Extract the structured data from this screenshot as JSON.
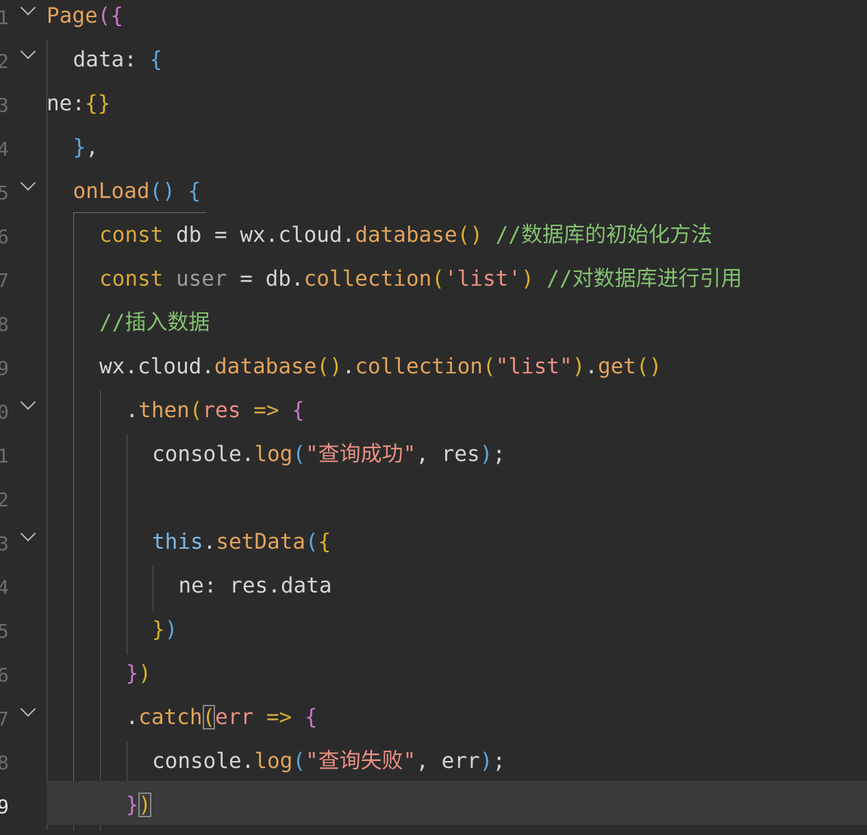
{
  "editor": {
    "current_line": "9",
    "lines": [
      {
        "no": "1",
        "indent": 0,
        "fold": true,
        "tokens": [
          {
            "t": "Page",
            "c": "fn"
          },
          {
            "t": "(",
            "c": "b2"
          },
          {
            "t": "{",
            "c": "b2"
          }
        ]
      },
      {
        "no": "2",
        "indent": 1,
        "fold": true,
        "tokens": [
          {
            "t": "data",
            "c": "plain"
          },
          {
            "t": ": ",
            "c": "plain"
          },
          {
            "t": "{",
            "c": "b3"
          }
        ]
      },
      {
        "no": "3",
        "indent": 0,
        "fold": false,
        "tokens": [
          {
            "t": "ne",
            "c": "plain"
          },
          {
            "t": ":",
            "c": "plain"
          },
          {
            "t": "{}",
            "c": "b1"
          }
        ]
      },
      {
        "no": "4",
        "indent": 1,
        "fold": false,
        "tokens": [
          {
            "t": "}",
            "c": "b3"
          },
          {
            "t": ",",
            "c": "plain"
          }
        ]
      },
      {
        "no": "5",
        "indent": 1,
        "fold": true,
        "tokens": [
          {
            "t": "onLoad",
            "c": "fn"
          },
          {
            "t": "()",
            "c": "b3"
          },
          {
            "t": " ",
            "c": "plain"
          },
          {
            "t": "{",
            "c": "b3"
          }
        ]
      },
      {
        "no": "6",
        "indent": 2,
        "fold": false,
        "tokens": [
          {
            "t": "const ",
            "c": "kw"
          },
          {
            "t": "db",
            "c": "plain"
          },
          {
            "t": " = ",
            "c": "plain"
          },
          {
            "t": "wx",
            "c": "plain"
          },
          {
            "t": ".",
            "c": "plain"
          },
          {
            "t": "cloud",
            "c": "plain"
          },
          {
            "t": ".",
            "c": "plain"
          },
          {
            "t": "database",
            "c": "fn"
          },
          {
            "t": "()",
            "c": "b1"
          },
          {
            "t": " ",
            "c": "plain"
          },
          {
            "t": "//数据库的初始化方法",
            "c": "cm"
          }
        ]
      },
      {
        "no": "7",
        "indent": 2,
        "fold": false,
        "tokens": [
          {
            "t": "const ",
            "c": "kw"
          },
          {
            "t": "user",
            "c": "var"
          },
          {
            "t": " = ",
            "c": "plain"
          },
          {
            "t": "db",
            "c": "plain"
          },
          {
            "t": ".",
            "c": "plain"
          },
          {
            "t": "collection",
            "c": "fn"
          },
          {
            "t": "(",
            "c": "b1"
          },
          {
            "t": "'list'",
            "c": "str"
          },
          {
            "t": ")",
            "c": "b1"
          },
          {
            "t": " ",
            "c": "plain"
          },
          {
            "t": "//对数据库进行引用",
            "c": "cm"
          }
        ]
      },
      {
        "no": "8",
        "indent": 2,
        "fold": false,
        "tokens": [
          {
            "t": "//插入数据",
            "c": "cm"
          }
        ]
      },
      {
        "no": "9",
        "indent": 2,
        "fold": false,
        "tokens": [
          {
            "t": "wx",
            "c": "plain"
          },
          {
            "t": ".",
            "c": "plain"
          },
          {
            "t": "cloud",
            "c": "plain"
          },
          {
            "t": ".",
            "c": "plain"
          },
          {
            "t": "database",
            "c": "fn"
          },
          {
            "t": "()",
            "c": "b1"
          },
          {
            "t": ".",
            "c": "plain"
          },
          {
            "t": "collection",
            "c": "fn"
          },
          {
            "t": "(",
            "c": "b1"
          },
          {
            "t": "\"list\"",
            "c": "str"
          },
          {
            "t": ")",
            "c": "b1"
          },
          {
            "t": ".",
            "c": "plain"
          },
          {
            "t": "get",
            "c": "fn"
          },
          {
            "t": "()",
            "c": "b1"
          }
        ]
      },
      {
        "no": "0",
        "indent": 3,
        "fold": true,
        "tokens": [
          {
            "t": ".",
            "c": "plain"
          },
          {
            "t": "then",
            "c": "fn"
          },
          {
            "t": "(",
            "c": "b1"
          },
          {
            "t": "res",
            "c": "param"
          },
          {
            "t": " => ",
            "c": "kw"
          },
          {
            "t": "{",
            "c": "b2"
          }
        ]
      },
      {
        "no": "1",
        "indent": 4,
        "fold": false,
        "tokens": [
          {
            "t": "console",
            "c": "plain"
          },
          {
            "t": ".",
            "c": "plain"
          },
          {
            "t": "log",
            "c": "fn"
          },
          {
            "t": "(",
            "c": "b3"
          },
          {
            "t": "\"查询成功\"",
            "c": "str"
          },
          {
            "t": ", ",
            "c": "plain"
          },
          {
            "t": "res",
            "c": "plain"
          },
          {
            "t": ")",
            "c": "b3"
          },
          {
            "t": ";",
            "c": "plain"
          }
        ]
      },
      {
        "no": "2",
        "indent": 4,
        "fold": false,
        "tokens": []
      },
      {
        "no": "3",
        "indent": 4,
        "fold": true,
        "tokens": [
          {
            "t": "this",
            "c": "this"
          },
          {
            "t": ".",
            "c": "plain"
          },
          {
            "t": "setData",
            "c": "fn"
          },
          {
            "t": "(",
            "c": "b3"
          },
          {
            "t": "{",
            "c": "b1"
          }
        ]
      },
      {
        "no": "4",
        "indent": 5,
        "fold": false,
        "tokens": [
          {
            "t": "ne",
            "c": "plain"
          },
          {
            "t": ": ",
            "c": "plain"
          },
          {
            "t": "res",
            "c": "plain"
          },
          {
            "t": ".",
            "c": "plain"
          },
          {
            "t": "data",
            "c": "plain"
          }
        ]
      },
      {
        "no": "5",
        "indent": 4,
        "fold": false,
        "tokens": [
          {
            "t": "}",
            "c": "b1"
          },
          {
            "t": ")",
            "c": "b3"
          }
        ]
      },
      {
        "no": "6",
        "indent": 3,
        "fold": false,
        "tokens": [
          {
            "t": "}",
            "c": "b2"
          },
          {
            "t": ")",
            "c": "b1"
          }
        ]
      },
      {
        "no": "7",
        "indent": 3,
        "fold": true,
        "tokens": [
          {
            "t": ".",
            "c": "plain"
          },
          {
            "t": "catch",
            "c": "fn"
          },
          {
            "t": "(",
            "c": "b1",
            "box": true
          },
          {
            "t": "err",
            "c": "param"
          },
          {
            "t": " => ",
            "c": "kw"
          },
          {
            "t": "{",
            "c": "b2"
          }
        ]
      },
      {
        "no": "8",
        "indent": 4,
        "fold": false,
        "tokens": [
          {
            "t": "console",
            "c": "plain"
          },
          {
            "t": ".",
            "c": "plain"
          },
          {
            "t": "log",
            "c": "fn"
          },
          {
            "t": "(",
            "c": "b3"
          },
          {
            "t": "\"查询失败\"",
            "c": "str"
          },
          {
            "t": ", ",
            "c": "plain"
          },
          {
            "t": "err",
            "c": "plain"
          },
          {
            "t": ")",
            "c": "b3"
          },
          {
            "t": ";",
            "c": "plain"
          }
        ]
      },
      {
        "no": "9",
        "indent": 3,
        "fold": false,
        "tokens": [
          {
            "t": "}",
            "c": "b2"
          },
          {
            "t": ")",
            "c": "b1",
            "box": true
          }
        ]
      }
    ]
  }
}
